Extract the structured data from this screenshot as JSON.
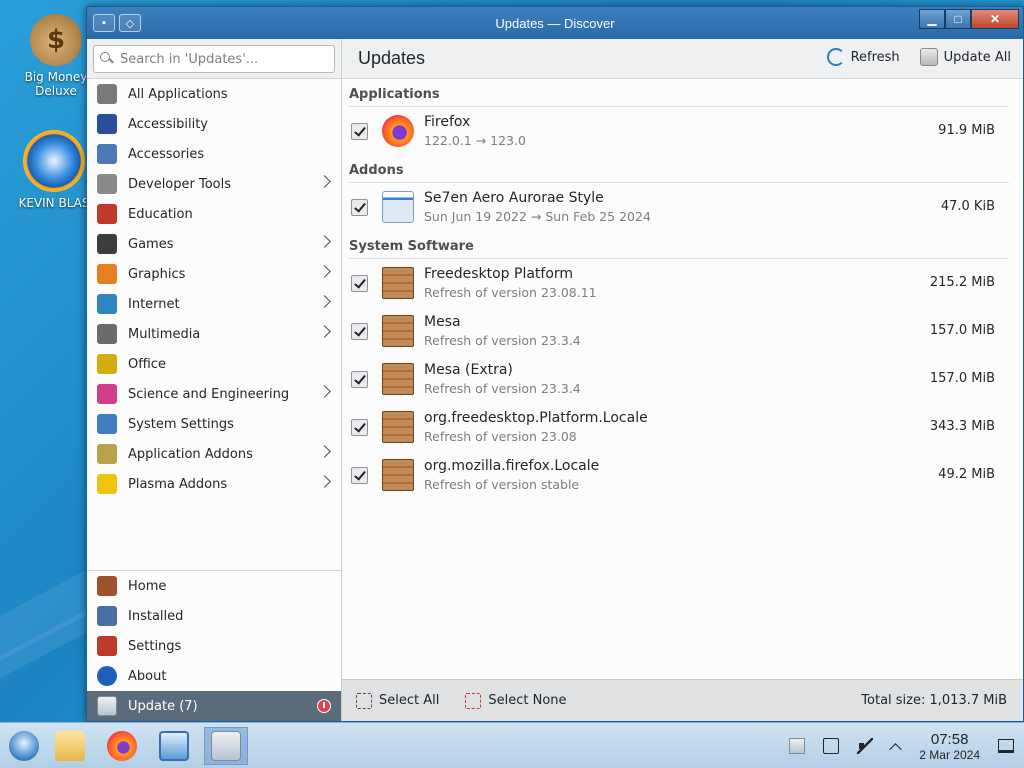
{
  "desktop": {
    "icons": [
      {
        "label": "Big Money Deluxe"
      },
      {
        "label": "KEVIN BLAS"
      }
    ]
  },
  "window": {
    "title": "Updates — Discover",
    "controls": {
      "minimize": "▁",
      "maximize": "□",
      "close": "✕"
    }
  },
  "sidebar": {
    "search_placeholder": "Search in 'Updates'...",
    "categories": [
      {
        "label": "All Applications",
        "icon": "grid-icon",
        "color": "#7a7a7a",
        "has_children": false
      },
      {
        "label": "Accessibility",
        "icon": "accessibility-icon",
        "color": "#2a4f9c",
        "has_children": false
      },
      {
        "label": "Accessories",
        "icon": "accessories-icon",
        "color": "#4d78b8",
        "has_children": false
      },
      {
        "label": "Developer Tools",
        "icon": "developer-tools-icon",
        "color": "#8a8a8a",
        "has_children": true
      },
      {
        "label": "Education",
        "icon": "education-icon",
        "color": "#c0392b",
        "has_children": false
      },
      {
        "label": "Games",
        "icon": "games-icon",
        "color": "#3d3d3d",
        "has_children": true
      },
      {
        "label": "Graphics",
        "icon": "graphics-icon",
        "color": "#e67e22",
        "has_children": true
      },
      {
        "label": "Internet",
        "icon": "internet-icon",
        "color": "#2e86c1",
        "has_children": true
      },
      {
        "label": "Multimedia",
        "icon": "multimedia-icon",
        "color": "#6b6b6b",
        "has_children": true
      },
      {
        "label": "Office",
        "icon": "office-icon",
        "color": "#d4ac0d",
        "has_children": false
      },
      {
        "label": "Science and Engineering",
        "icon": "science-icon",
        "color": "#cf3f8a",
        "has_children": true
      },
      {
        "label": "System Settings",
        "icon": "system-settings-icon",
        "color": "#3f7fbf",
        "has_children": false
      },
      {
        "label": "Application Addons",
        "icon": "application-addons-icon",
        "color": "#b8a24a",
        "has_children": true
      },
      {
        "label": "Plasma Addons",
        "icon": "plasma-addons-icon",
        "color": "#f1c40f",
        "has_children": true
      }
    ],
    "bottom_nav": [
      {
        "label": "Home",
        "icon": "home-icon",
        "color": "#a0522d"
      },
      {
        "label": "Installed",
        "icon": "installed-icon",
        "color": "#4a6fa5"
      },
      {
        "label": "Settings",
        "icon": "settings-icon",
        "color": "#c0392b"
      },
      {
        "label": "About",
        "icon": "about-icon",
        "color": "#1f5fb8"
      }
    ],
    "update_item": {
      "label": "Update (7)",
      "icon": "update-icon"
    }
  },
  "main": {
    "title": "Updates",
    "actions": {
      "refresh": "Refresh",
      "update_all": "Update All"
    },
    "sections": [
      {
        "title": "Applications",
        "items": [
          {
            "name": "Firefox",
            "sub": "122.0.1 → 123.0",
            "size": "91.9 MiB",
            "icon": "firefox-icon"
          }
        ]
      },
      {
        "title": "Addons",
        "items": [
          {
            "name": "Se7en Aero Aurorae Style",
            "sub": "Sun Jun 19 2022 → Sun Feb 25 2024",
            "size": "47.0 KiB",
            "icon": "aurorae-theme-icon"
          }
        ]
      },
      {
        "title": "System Software",
        "items": [
          {
            "name": "Freedesktop Platform",
            "sub": "Refresh of version 23.08.11",
            "size": "215.2 MiB",
            "icon": "package-icon"
          },
          {
            "name": "Mesa",
            "sub": "Refresh of version 23.3.4",
            "size": "157.0 MiB",
            "icon": "package-icon"
          },
          {
            "name": "Mesa (Extra)",
            "sub": "Refresh of version 23.3.4",
            "size": "157.0 MiB",
            "icon": "package-icon"
          },
          {
            "name": "org.freedesktop.Platform.Locale",
            "sub": "Refresh of version 23.08",
            "size": "343.3 MiB",
            "icon": "package-icon"
          },
          {
            "name": "org.mozilla.firefox.Locale",
            "sub": "Refresh of version stable",
            "size": "49.2 MiB",
            "icon": "package-icon"
          }
        ]
      }
    ],
    "footer": {
      "select_all": "Select All",
      "select_none": "Select None",
      "total": "Total size: 1,013.7 MiB"
    }
  },
  "taskbar": {
    "clock_time": "07:58",
    "clock_date": "2 Mar 2024"
  },
  "colors": {
    "titlebar": "#2c6aa8",
    "active_nav": "#5a6b7c",
    "badge": "#da4453"
  }
}
